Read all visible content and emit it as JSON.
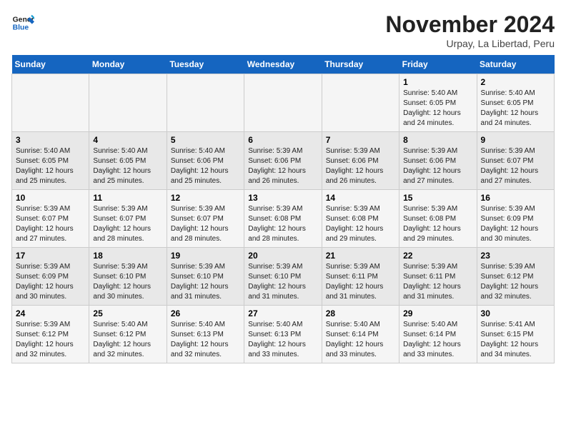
{
  "header": {
    "logo_line1": "General",
    "logo_line2": "Blue",
    "title": "November 2024",
    "subtitle": "Urpay, La Libertad, Peru"
  },
  "weekdays": [
    "Sunday",
    "Monday",
    "Tuesday",
    "Wednesday",
    "Thursday",
    "Friday",
    "Saturday"
  ],
  "weeks": [
    [
      {
        "day": "",
        "info": ""
      },
      {
        "day": "",
        "info": ""
      },
      {
        "day": "",
        "info": ""
      },
      {
        "day": "",
        "info": ""
      },
      {
        "day": "",
        "info": ""
      },
      {
        "day": "1",
        "info": "Sunrise: 5:40 AM\nSunset: 6:05 PM\nDaylight: 12 hours\nand 24 minutes."
      },
      {
        "day": "2",
        "info": "Sunrise: 5:40 AM\nSunset: 6:05 PM\nDaylight: 12 hours\nand 24 minutes."
      }
    ],
    [
      {
        "day": "3",
        "info": "Sunrise: 5:40 AM\nSunset: 6:05 PM\nDaylight: 12 hours\nand 25 minutes."
      },
      {
        "day": "4",
        "info": "Sunrise: 5:40 AM\nSunset: 6:05 PM\nDaylight: 12 hours\nand 25 minutes."
      },
      {
        "day": "5",
        "info": "Sunrise: 5:40 AM\nSunset: 6:06 PM\nDaylight: 12 hours\nand 25 minutes."
      },
      {
        "day": "6",
        "info": "Sunrise: 5:39 AM\nSunset: 6:06 PM\nDaylight: 12 hours\nand 26 minutes."
      },
      {
        "day": "7",
        "info": "Sunrise: 5:39 AM\nSunset: 6:06 PM\nDaylight: 12 hours\nand 26 minutes."
      },
      {
        "day": "8",
        "info": "Sunrise: 5:39 AM\nSunset: 6:06 PM\nDaylight: 12 hours\nand 27 minutes."
      },
      {
        "day": "9",
        "info": "Sunrise: 5:39 AM\nSunset: 6:07 PM\nDaylight: 12 hours\nand 27 minutes."
      }
    ],
    [
      {
        "day": "10",
        "info": "Sunrise: 5:39 AM\nSunset: 6:07 PM\nDaylight: 12 hours\nand 27 minutes."
      },
      {
        "day": "11",
        "info": "Sunrise: 5:39 AM\nSunset: 6:07 PM\nDaylight: 12 hours\nand 28 minutes."
      },
      {
        "day": "12",
        "info": "Sunrise: 5:39 AM\nSunset: 6:07 PM\nDaylight: 12 hours\nand 28 minutes."
      },
      {
        "day": "13",
        "info": "Sunrise: 5:39 AM\nSunset: 6:08 PM\nDaylight: 12 hours\nand 28 minutes."
      },
      {
        "day": "14",
        "info": "Sunrise: 5:39 AM\nSunset: 6:08 PM\nDaylight: 12 hours\nand 29 minutes."
      },
      {
        "day": "15",
        "info": "Sunrise: 5:39 AM\nSunset: 6:08 PM\nDaylight: 12 hours\nand 29 minutes."
      },
      {
        "day": "16",
        "info": "Sunrise: 5:39 AM\nSunset: 6:09 PM\nDaylight: 12 hours\nand 30 minutes."
      }
    ],
    [
      {
        "day": "17",
        "info": "Sunrise: 5:39 AM\nSunset: 6:09 PM\nDaylight: 12 hours\nand 30 minutes."
      },
      {
        "day": "18",
        "info": "Sunrise: 5:39 AM\nSunset: 6:10 PM\nDaylight: 12 hours\nand 30 minutes."
      },
      {
        "day": "19",
        "info": "Sunrise: 5:39 AM\nSunset: 6:10 PM\nDaylight: 12 hours\nand 31 minutes."
      },
      {
        "day": "20",
        "info": "Sunrise: 5:39 AM\nSunset: 6:10 PM\nDaylight: 12 hours\nand 31 minutes."
      },
      {
        "day": "21",
        "info": "Sunrise: 5:39 AM\nSunset: 6:11 PM\nDaylight: 12 hours\nand 31 minutes."
      },
      {
        "day": "22",
        "info": "Sunrise: 5:39 AM\nSunset: 6:11 PM\nDaylight: 12 hours\nand 31 minutes."
      },
      {
        "day": "23",
        "info": "Sunrise: 5:39 AM\nSunset: 6:12 PM\nDaylight: 12 hours\nand 32 minutes."
      }
    ],
    [
      {
        "day": "24",
        "info": "Sunrise: 5:39 AM\nSunset: 6:12 PM\nDaylight: 12 hours\nand 32 minutes."
      },
      {
        "day": "25",
        "info": "Sunrise: 5:40 AM\nSunset: 6:12 PM\nDaylight: 12 hours\nand 32 minutes."
      },
      {
        "day": "26",
        "info": "Sunrise: 5:40 AM\nSunset: 6:13 PM\nDaylight: 12 hours\nand 32 minutes."
      },
      {
        "day": "27",
        "info": "Sunrise: 5:40 AM\nSunset: 6:13 PM\nDaylight: 12 hours\nand 33 minutes."
      },
      {
        "day": "28",
        "info": "Sunrise: 5:40 AM\nSunset: 6:14 PM\nDaylight: 12 hours\nand 33 minutes."
      },
      {
        "day": "29",
        "info": "Sunrise: 5:40 AM\nSunset: 6:14 PM\nDaylight: 12 hours\nand 33 minutes."
      },
      {
        "day": "30",
        "info": "Sunrise: 5:41 AM\nSunset: 6:15 PM\nDaylight: 12 hours\nand 34 minutes."
      }
    ]
  ]
}
